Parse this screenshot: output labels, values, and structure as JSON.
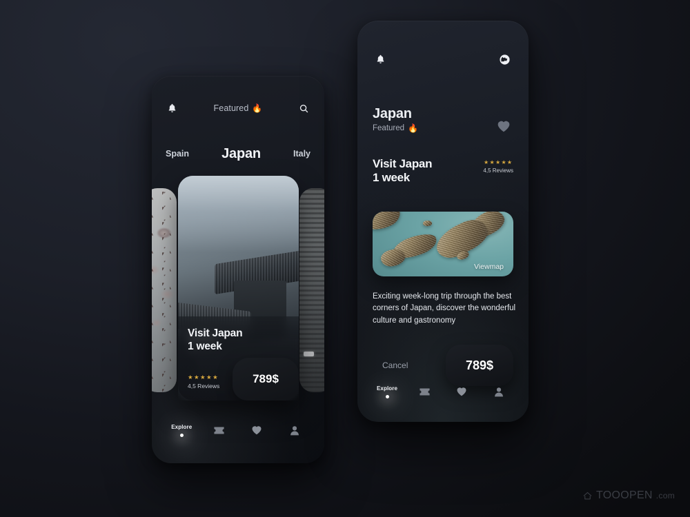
{
  "background": {
    "base_color": "#1c1f28",
    "edge_color": "#0b0c0f"
  },
  "accent": {
    "star_gold": "#d8a943",
    "text_primary": "#f2f4f8",
    "text_muted": "#a9aeb9"
  },
  "home_screen": {
    "top_bar": {
      "bell_icon": "bell-icon",
      "featured_label": "Featured",
      "flame_icon": "🔥",
      "search_icon": "search-icon"
    },
    "country_nav": {
      "prev": "Spain",
      "active": "Japan",
      "next": "Italy"
    },
    "card": {
      "title_line1": "Visit Japan",
      "title_line2": "1 week",
      "stars": "★★★★★",
      "reviews": "4,5 Reviews",
      "price": "789$"
    },
    "tabbar": {
      "items": [
        {
          "label": "Explore",
          "icon": "dot-indicator",
          "active": true
        },
        {
          "label": "",
          "icon": "ticket-icon",
          "active": false
        },
        {
          "label": "",
          "icon": "heart-icon",
          "active": false
        },
        {
          "label": "",
          "icon": "person-icon",
          "active": false
        }
      ]
    }
  },
  "detail_screen": {
    "top_bar": {
      "bell_icon": "bell-icon",
      "globe_icon": "globe-icon"
    },
    "header": {
      "country": "Japan",
      "featured_label": "Featured",
      "flame_icon": "🔥",
      "favorite_icon": "heart-icon"
    },
    "trip": {
      "title_line1": "Visit Japan",
      "title_line2": "1 week",
      "stars": "★★★★★",
      "reviews": "4,5 Reviews"
    },
    "map": {
      "label": "Viewmap"
    },
    "description": "Exciting week-long trip through the best corners of Japan, discover the wonderful culture and gastronomy",
    "actions": {
      "cancel_label": "Cancel",
      "price": "789$"
    },
    "tabbar": {
      "items": [
        {
          "label": "Explore",
          "icon": "dot-indicator",
          "active": true
        },
        {
          "label": "",
          "icon": "ticket-icon",
          "active": false
        },
        {
          "label": "",
          "icon": "heart-icon",
          "active": false
        },
        {
          "label": "",
          "icon": "person-icon",
          "active": false
        }
      ]
    }
  },
  "watermark": {
    "brand": "TOOOPEN",
    "domain": ".com",
    "icon": "cloud-home-icon"
  }
}
